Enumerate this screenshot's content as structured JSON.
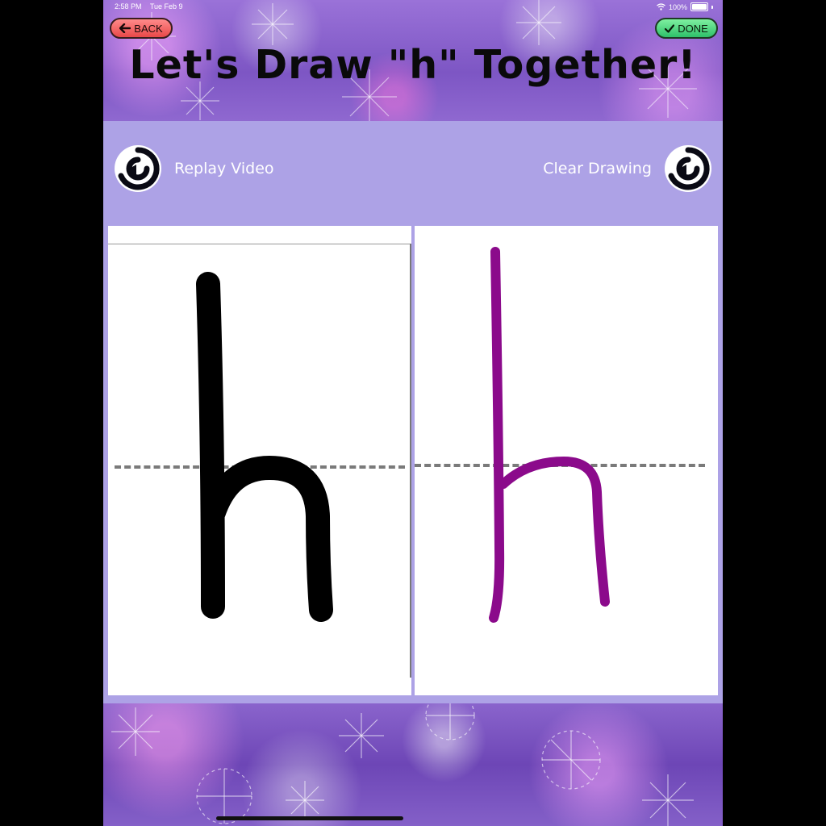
{
  "status_bar": {
    "time": "2:58 PM",
    "date": "Tue Feb 9",
    "battery": "100%"
  },
  "header": {
    "title": "Let's Draw \"h\" Together!",
    "back_label": "BACK",
    "done_label": "DONE"
  },
  "controls": {
    "replay_label": "Replay Video",
    "clear_label": "Clear Drawing"
  },
  "colors": {
    "back_button": "#e84848",
    "done_button": "#2ec06a",
    "band": "#ada2e6",
    "model_stroke": "#000000",
    "user_stroke": "#8b0a8b"
  },
  "icons": [
    "back-arrow-icon",
    "checkmark-icon",
    "replay-icon",
    "clear-icon",
    "wifi-icon",
    "battery-icon"
  ]
}
